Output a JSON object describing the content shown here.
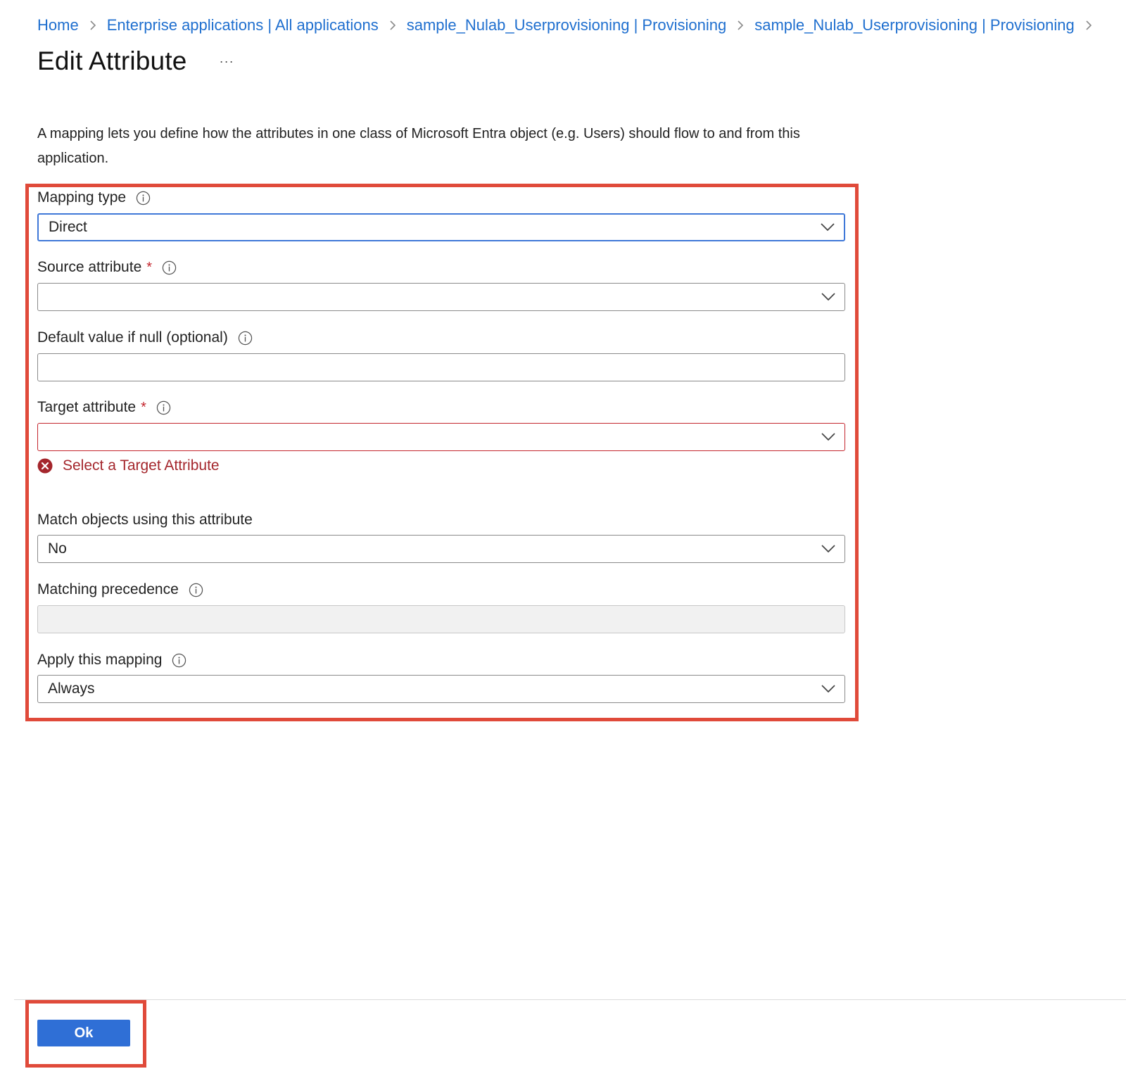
{
  "breadcrumb": {
    "items": [
      {
        "label": "Home"
      },
      {
        "label": "Enterprise applications | All applications"
      },
      {
        "label": "sample_Nulab_Userprovisioning | Provisioning"
      },
      {
        "label": "sample_Nulab_Userprovisioning | Provisioning"
      }
    ],
    "separator_icon": "chevron-right-icon"
  },
  "header": {
    "title": "Edit Attribute",
    "more_label": "···"
  },
  "description": "A mapping lets you define how the attributes in one class of Microsoft Entra object (e.g. Users) should flow to and from this application.",
  "form": {
    "mapping_type": {
      "label": "Mapping type",
      "value": "Direct"
    },
    "source_attribute": {
      "label": "Source attribute",
      "required_mark": "*",
      "value": ""
    },
    "default_value": {
      "label": "Default value if null (optional)",
      "value": ""
    },
    "target_attribute": {
      "label": "Target attribute",
      "required_mark": "*",
      "value": "",
      "error": "Select a Target Attribute"
    },
    "match_objects": {
      "label": "Match objects using this attribute",
      "value": "No"
    },
    "matching_precedence": {
      "label": "Matching precedence",
      "value": ""
    },
    "apply_mapping": {
      "label": "Apply this mapping",
      "value": "Always"
    }
  },
  "footer": {
    "ok_label": "Ok"
  },
  "colors": {
    "link": "#1f6fcf",
    "primary": "#2f6fd6",
    "error": "#c4262e",
    "highlight": "#e04a3a"
  }
}
